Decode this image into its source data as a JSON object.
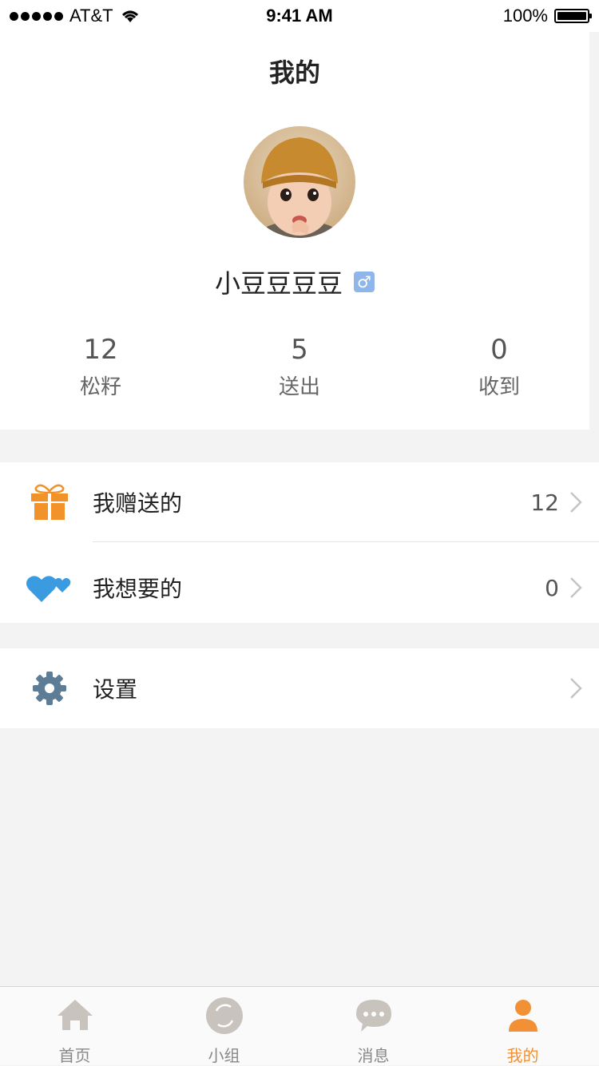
{
  "status_bar": {
    "carrier": "AT&T",
    "time": "9:41 AM",
    "battery": "100%"
  },
  "profile": {
    "title": "我的",
    "username": "小豆豆豆豆",
    "gender_symbol": "♂",
    "stats": [
      {
        "value": "12",
        "label": "松籽"
      },
      {
        "value": "5",
        "label": "送出"
      },
      {
        "value": "0",
        "label": "收到"
      }
    ]
  },
  "menu": {
    "gifts_sent": {
      "label": "我赠送的",
      "count": "12",
      "icon": "gift-icon"
    },
    "wishlist": {
      "label": "我想要的",
      "count": "0",
      "icon": "hearts-icon"
    },
    "settings": {
      "label": "设置",
      "icon": "gear-icon"
    }
  },
  "tab_bar": {
    "tabs": [
      {
        "label": "首页",
        "icon": "home-icon"
      },
      {
        "label": "小组",
        "icon": "group-icon"
      },
      {
        "label": "消息",
        "icon": "chat-icon"
      },
      {
        "label": "我的",
        "icon": "person-icon"
      }
    ],
    "active_color": "#f29035",
    "inactive_color": "#888888"
  },
  "colors": {
    "gift": "#f2922b",
    "heart": "#3a9be0",
    "gear": "#5d7d96",
    "gender_badge": "#8fb6ea"
  }
}
